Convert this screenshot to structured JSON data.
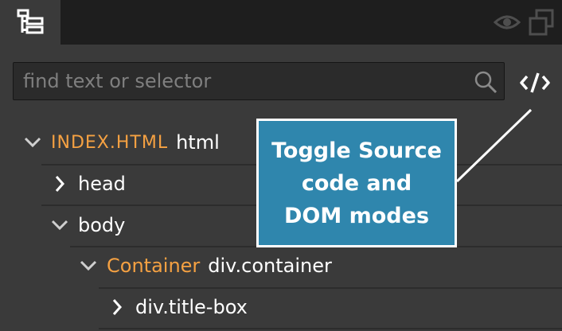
{
  "search": {
    "placeholder": "find text or selector"
  },
  "icons": {
    "tree_tab": "tree-icon",
    "visibility": "eye-icon",
    "copy": "copy-icon",
    "search": "search-icon",
    "code_toggle": "code-icon",
    "expanded": "chevron-down-icon",
    "collapsed": "chevron-right-icon"
  },
  "tree": {
    "root": {
      "file_label": "INDEX.HTML",
      "tag": "html",
      "expanded": true
    },
    "head": {
      "tag": "head",
      "expanded": false
    },
    "body": {
      "tag": "body",
      "expanded": true
    },
    "container": {
      "component": "Container",
      "tag": "div.container",
      "expanded": true
    },
    "title_box": {
      "tag": "div.title-box",
      "expanded": false
    }
  },
  "callout": {
    "line1": "Toggle Source",
    "line2": "code and",
    "line3": "DOM modes"
  },
  "colors": {
    "background": "#3a3a3a",
    "topbar": "#1e1e1e",
    "accent_orange": "#f5a142",
    "callout_blue": "#2f86ad",
    "text": "#ffffff",
    "placeholder": "#7f7f7f"
  }
}
